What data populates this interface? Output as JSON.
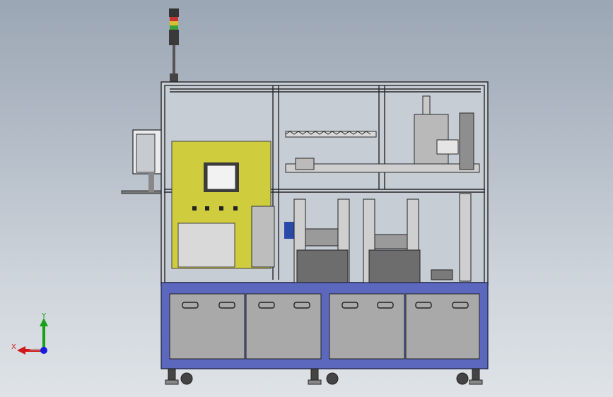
{
  "viewport": {
    "background_top": "#9ba6b4",
    "background_bottom": "#dfe3e7"
  },
  "model": {
    "frame_color": "#2b2b2b",
    "base_color": "#5c6bc0",
    "panel_color": "#a9a9a9",
    "enclosure_color": "#d6e0c0",
    "stack_light": [
      "red",
      "yellow",
      "green"
    ]
  },
  "triad": {
    "x_label": "X",
    "y_label": "Y",
    "x_color": "#d01818",
    "y_color": "#18a018",
    "z_color": "#1a1ae0"
  }
}
